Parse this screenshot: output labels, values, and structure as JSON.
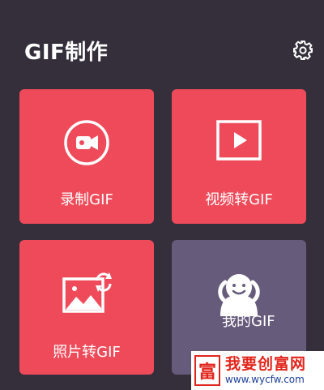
{
  "header": {
    "title": "GIF制作",
    "settings_icon": "gear-icon"
  },
  "cards": [
    {
      "label": "录制GIF",
      "icon": "video-camera-icon",
      "color": "#ef4a5a"
    },
    {
      "label": "视频转GIF",
      "icon": "play-icon",
      "color": "#ef4a5a"
    },
    {
      "label": "照片转GIF",
      "icon": "image-rotate-icon",
      "color": "#ef4a5a"
    },
    {
      "label": "我的GIF",
      "icon": "smiley-figure-icon",
      "color": "#675b7b"
    }
  ],
  "watermark": {
    "logo_char": "富",
    "title": "我要创富网",
    "url": "www.wycfw.com"
  },
  "colors": {
    "background": "#352f3b",
    "accent": "#ef4a5a",
    "secondary": "#675b7b"
  }
}
